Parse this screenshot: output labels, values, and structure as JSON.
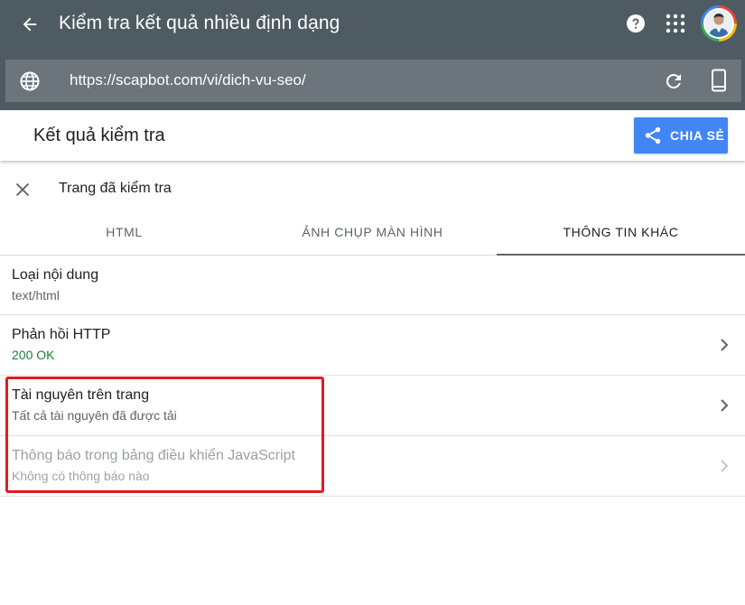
{
  "header": {
    "title": "Kiểm tra kết quả nhiều định dạng",
    "url": "https://scapbot.com/vi/dich-vu-seo/"
  },
  "result": {
    "title": "Kết quả kiểm tra",
    "share_label": "CHIA SẺ"
  },
  "panel": {
    "title": "Trang đã kiểm tra",
    "tabs": [
      {
        "label": "HTML",
        "active": false
      },
      {
        "label": "ẢNH CHỤP MÀN HÌNH",
        "active": false
      },
      {
        "label": "THÔNG TIN KHÁC",
        "active": true
      }
    ],
    "rows": [
      {
        "title": "Loại nội dung",
        "subtitle": "text/html"
      },
      {
        "title": "Phản hồi HTTP",
        "subtitle": "200 OK"
      },
      {
        "title": "Tài nguyên trên trang",
        "subtitle": "Tất cả tài nguyên đã được tải"
      },
      {
        "title": "Thông báo trong bảng điều khiển JavaScript",
        "subtitle": "Không có thông báo nào"
      }
    ]
  },
  "colors": {
    "header_bg": "#4f5b62",
    "urlbar_bg": "#6b757b",
    "accent": "#4285f4",
    "status_ok": "#188038",
    "highlight": "#e31b23"
  },
  "icons": [
    "arrow-back-icon",
    "help-icon",
    "apps-grid-icon",
    "avatar",
    "globe-icon",
    "refresh-icon",
    "smartphone-icon",
    "share-icon",
    "close-icon",
    "chevron-right-icon"
  ]
}
